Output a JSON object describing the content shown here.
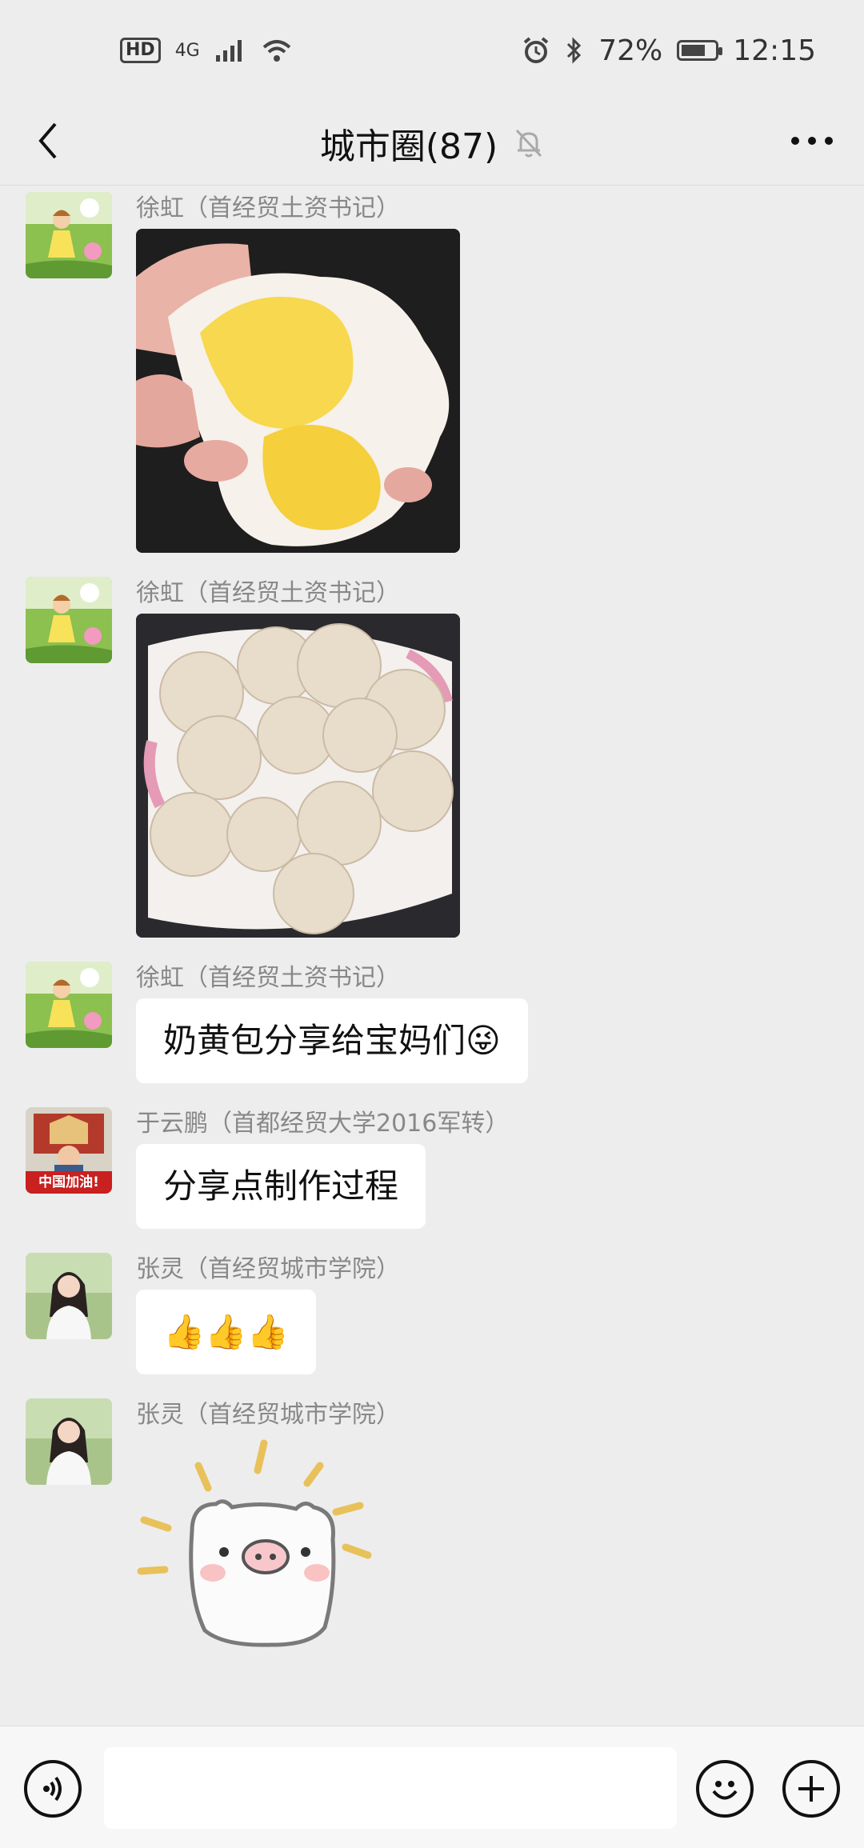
{
  "status_bar": {
    "hd": "HD",
    "network": "4G",
    "battery_percent": "72%",
    "battery_level": 0.72,
    "time": "12:15"
  },
  "header": {
    "title": "城市圈(87)",
    "back_icon": "chevron-left-icon",
    "mute_icon": "bell-off-icon",
    "more_icon": "more-icon"
  },
  "messages": [
    {
      "sender": "徐虹（首经贸土资书记）",
      "type": "image",
      "image": "custard-bun-opened-photo"
    },
    {
      "sender": "徐虹（首经贸土资书记）",
      "type": "image",
      "image": "steamed-buns-plate-photo"
    },
    {
      "sender": "徐虹（首经贸土资书记）",
      "type": "text",
      "text": "奶黄包分享给宝妈们😜"
    },
    {
      "sender": "于云鹏（首都经贸大学2016军转）",
      "type": "text",
      "text": "分享点制作过程",
      "avatar_caption": "中国加油!"
    },
    {
      "sender": "张灵（首经贸城市学院）",
      "type": "text",
      "text": "👍👍👍"
    },
    {
      "sender": "张灵（首经贸城市学院）",
      "type": "sticker",
      "image": "piggy-sticker"
    }
  ],
  "input_bar": {
    "voice_icon": "voice-icon",
    "emoji_icon": "emoji-icon",
    "plus_icon": "plus-icon",
    "placeholder": ""
  },
  "colors": {
    "background": "#ededed",
    "bubble": "#ffffff",
    "sender_text": "#888888"
  }
}
